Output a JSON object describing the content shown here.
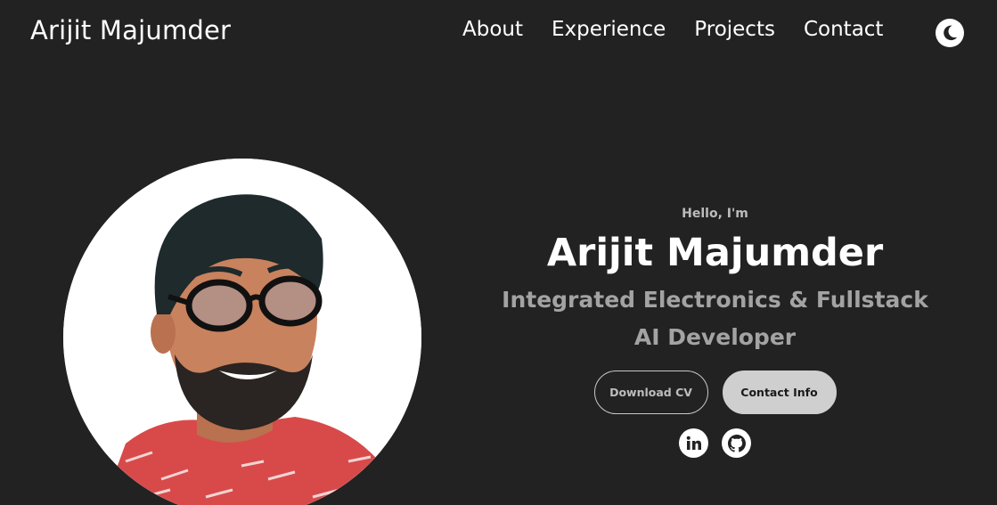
{
  "header": {
    "brand": "Arijit Majumder",
    "nav": [
      {
        "label": "About"
      },
      {
        "label": "Experience"
      },
      {
        "label": "Projects"
      },
      {
        "label": "Contact"
      }
    ],
    "theme_toggle_icon": "moon-icon"
  },
  "hero": {
    "greeting": "Hello, I'm",
    "name": "Arijit Majumder",
    "role_line1": "Integrated Electronics & Fullstack",
    "role_line2": "AI Developer",
    "download_cv": "Download CV",
    "contact_info": "Contact Info",
    "socials": [
      {
        "icon": "linkedin-icon",
        "text": "in"
      },
      {
        "icon": "github-icon"
      }
    ]
  },
  "colors": {
    "background": "#222222",
    "text": "#ffffff",
    "muted": "#a3a3a3",
    "button_fill": "#cfcfcf"
  }
}
